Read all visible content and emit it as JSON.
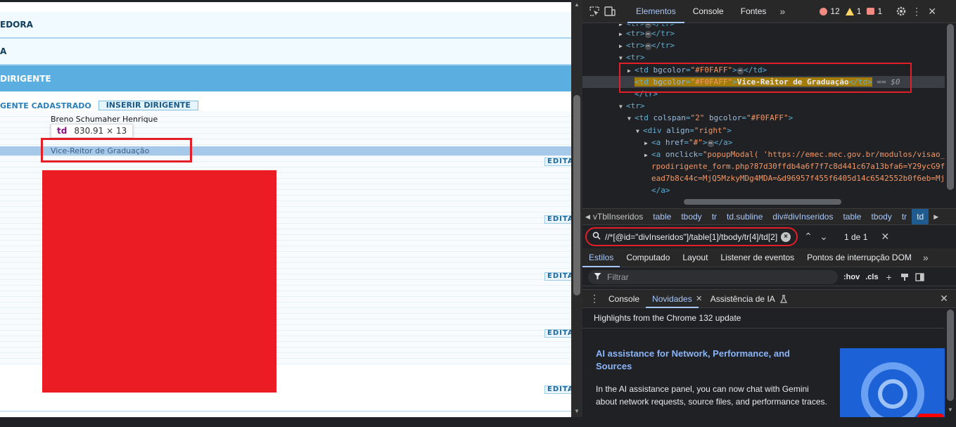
{
  "page": {
    "header1": "EDORA",
    "header2": "A",
    "header3": "DIRIGENTE",
    "tab_cadastrado": "GENTE CADASTRADO",
    "tab_inserir": "INSERIR DIRIGENTE",
    "name": "Breno Schumaher Henrique",
    "tooltip_tag": "td",
    "tooltip_dims": "830.91 × 13",
    "highlighted_text": "Vice-Reitor de Graduação",
    "edit_label": "EDITA"
  },
  "devtools": {
    "tabs": [
      "Elementos",
      "Console",
      "Fontes"
    ],
    "more": "»",
    "errors": "12",
    "warnings": "1",
    "issues": "1",
    "dom": {
      "tr": "tr",
      "td": "td",
      "div": "div",
      "a": "a",
      "bgcolor_attr": "bgcolor",
      "bgcolor_val": "\"#F0FAFF\"",
      "colspan_attr": "colspan",
      "colspan_val": "\"2\"",
      "align_attr": "align",
      "align_val": "\"right\"",
      "href_attr": "href",
      "href_val": "\"#\"",
      "onclick_attr": "onclick",
      "onclick_val1": "\"popupModal( 'https://emec.mec.gov.br/modulos/visao_",
      "onclick_val2": "rpodirigente_form.php?87d30ffdb4a6f7f7c8d441c67a13bfa6=Y29ycG9f",
      "onclick_val3": "ead7b8c44c=MjQ5MzkyMDg4MDA=&d96957f455f6405d14c6542552b0f6eb=Mj",
      "selected_text": "Vice-Reitor de Graduação",
      "eq": "== $0",
      "dots": "⋯"
    },
    "crumbs": [
      "vTblInseridos",
      "table",
      "tbody",
      "tr",
      "td.subline",
      "div#divInseridos",
      "table",
      "tbody",
      "tr",
      "td"
    ],
    "search_query": "//*[@id=\"divInseridos\"]/table[1]/tbody/tr[4]/td[2]",
    "search_count": "1 de 1",
    "style_tabs": [
      "Estilos",
      "Computado",
      "Layout",
      "Listener de eventos",
      "Pontos de interrupção DOM"
    ],
    "filter_placeholder": "Filtrar",
    "hov": ":hov",
    "cls": ".cls",
    "drawer_tabs": [
      "Console",
      "Novidades",
      "Assistência de IA"
    ],
    "news_header": "Highlights from the Chrome 132 update",
    "news_title": "AI assistance for Network, Performance, and Sources",
    "news_body": "In the AI assistance panel, you can now chat with Gemini about network requests, source files, and performance traces."
  },
  "colors": {
    "accent": "#a8c7fa",
    "highlight_red": "#e31e26",
    "section_blue": "#5aaee0"
  }
}
